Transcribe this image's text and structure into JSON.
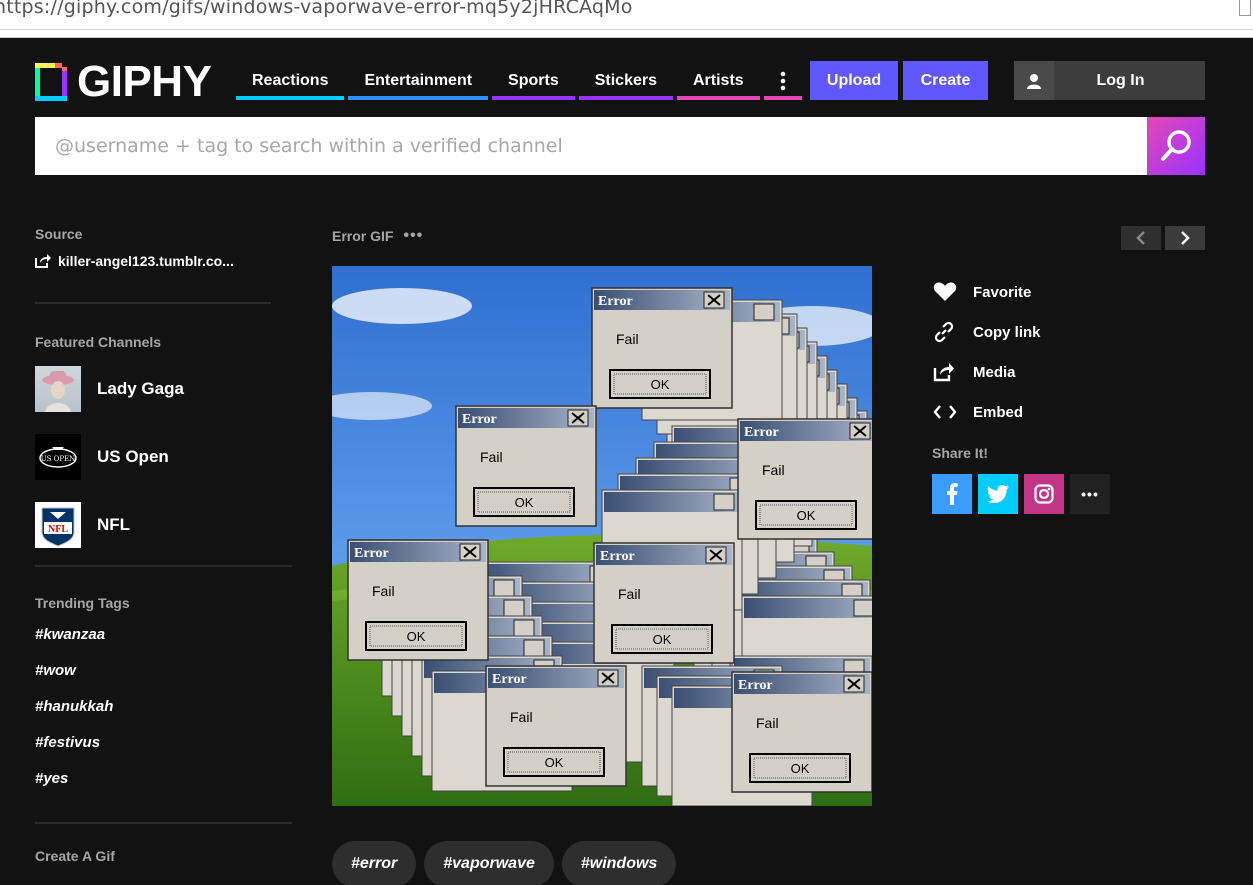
{
  "browser": {
    "url": "https://giphy.com/gifs/windows-vaporwave-error-mq5y2jHRCAqMo"
  },
  "header": {
    "logo_text": "GIPHY",
    "nav": [
      {
        "label": "Reactions",
        "color": "#00ccff"
      },
      {
        "label": "Entertainment",
        "color": "#3191ff"
      },
      {
        "label": "Sports",
        "color": "#9933ff"
      },
      {
        "label": "Stickers",
        "color": "#9933ff"
      },
      {
        "label": "Artists",
        "color": "#e646b6"
      }
    ],
    "more_icon": "vertical-dots-icon",
    "upload_label": "Upload",
    "create_label": "Create",
    "login_label": "Log In"
  },
  "search": {
    "placeholder": "@username + tag to search within a verified channel"
  },
  "sidebar": {
    "source_title": "Source",
    "source_link": "killer-angel123.tumblr.co...",
    "featured_title": "Featured Channels",
    "channels": [
      {
        "name": "Lady Gaga"
      },
      {
        "name": "US Open"
      },
      {
        "name": "NFL"
      }
    ],
    "trending_title": "Trending Tags",
    "trending": [
      "#kwanzaa",
      "#wow",
      "#hanukkah",
      "#festivus",
      "#yes"
    ],
    "create_title": "Create A Gif"
  },
  "gif": {
    "title": "Error GIF",
    "more": "•••",
    "dialog": {
      "title": "Error",
      "message": "Fail",
      "button": "OK"
    }
  },
  "tags": [
    "#error",
    "#vaporwave",
    "#windows"
  ],
  "actions": [
    {
      "label": "Favorite",
      "icon": "heart-icon"
    },
    {
      "label": "Copy link",
      "icon": "link-icon"
    },
    {
      "label": "Media",
      "icon": "share-arrow-icon"
    },
    {
      "label": "Embed",
      "icon": "code-brackets-icon"
    }
  ],
  "share": {
    "title": "Share It!",
    "buttons": [
      {
        "name": "facebook",
        "glyph": "f",
        "color": "#3b9cff"
      },
      {
        "name": "twitter",
        "glyph": "t",
        "color": "#00ccff"
      },
      {
        "name": "instagram",
        "glyph": "ig",
        "color": "#c13584"
      },
      {
        "name": "more",
        "glyph": "•••",
        "color": "#212121"
      }
    ]
  },
  "colors": {
    "accent": "#6157ff",
    "background": "#121212"
  }
}
